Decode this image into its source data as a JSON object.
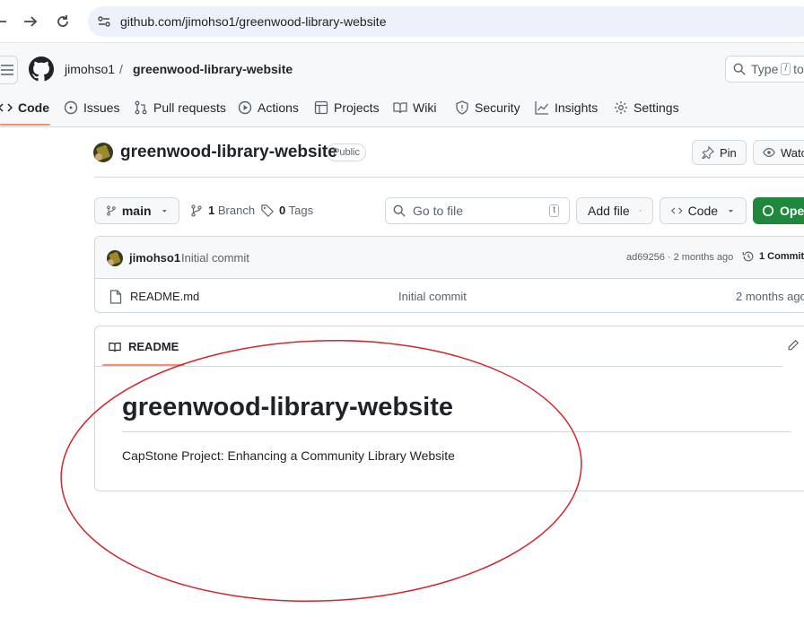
{
  "browser": {
    "url": "github.com/jimohso1/greenwood-library-website"
  },
  "header": {
    "owner": "jimohso1",
    "separator": "/",
    "repo": "greenwood-library-website",
    "search": {
      "prefix": "Type",
      "key": "/",
      "suffix": "to"
    }
  },
  "tabs": [
    {
      "label": "Code",
      "icon": "code-icon"
    },
    {
      "label": "Issues",
      "icon": "issue-icon"
    },
    {
      "label": "Pull requests",
      "icon": "pull-request-icon"
    },
    {
      "label": "Actions",
      "icon": "play-icon"
    },
    {
      "label": "Projects",
      "icon": "table-icon"
    },
    {
      "label": "Wiki",
      "icon": "book-icon"
    },
    {
      "label": "Security",
      "icon": "shield-icon"
    },
    {
      "label": "Insights",
      "icon": "graph-icon"
    },
    {
      "label": "Settings",
      "icon": "gear-icon"
    }
  ],
  "repo": {
    "name": "greenwood-library-website",
    "visibility": "Public",
    "pin_label": "Pin",
    "watch_label": "Watch"
  },
  "toolbar": {
    "branch": "main",
    "branch_count": "1",
    "branch_label": "Branch",
    "tag_count": "0",
    "tag_label": "Tags",
    "goto_placeholder": "Go to file",
    "goto_key": "t",
    "add_file": "Add file",
    "code": "Code",
    "open": "Open"
  },
  "commit": {
    "author": "jimohso1",
    "message": "Initial commit",
    "meta": "ad69256 · 2 months ago",
    "count": "1 Commit"
  },
  "files": [
    {
      "name": "README.md",
      "message": "Initial commit",
      "age": "2 months ago"
    }
  ],
  "readme": {
    "label": "README",
    "heading": "greenwood-library-website",
    "body": "CapStone Project: Enhancing a Community Library Website"
  },
  "colors": {
    "accent_underline": "#fd8c73",
    "green_button": "#1f883d",
    "annotation": "#d3242b"
  }
}
